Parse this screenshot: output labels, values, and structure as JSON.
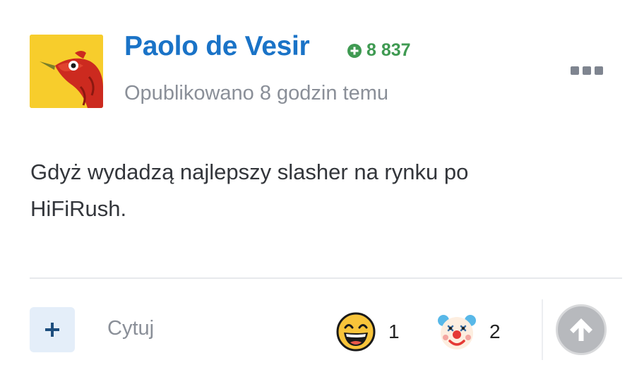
{
  "post": {
    "author": "Paolo de Vesir",
    "reputation": "8 837",
    "published": "Opublikowano 8 godzin temu",
    "content": "Gdyż wydadzą najlepszy slasher na rynku po HiFiRush."
  },
  "actions": {
    "quote_label": "Cytuj",
    "reactions": [
      {
        "icon": "laughing-face-icon",
        "count": "1"
      },
      {
        "icon": "clown-face-icon",
        "count": "2"
      }
    ]
  },
  "colors": {
    "author": "#1a73c7",
    "reputation": "#3f9a52",
    "muted": "#8a8f98",
    "add_button_bg": "#e4eef9",
    "upvote_bg": "#b7b9bd"
  }
}
